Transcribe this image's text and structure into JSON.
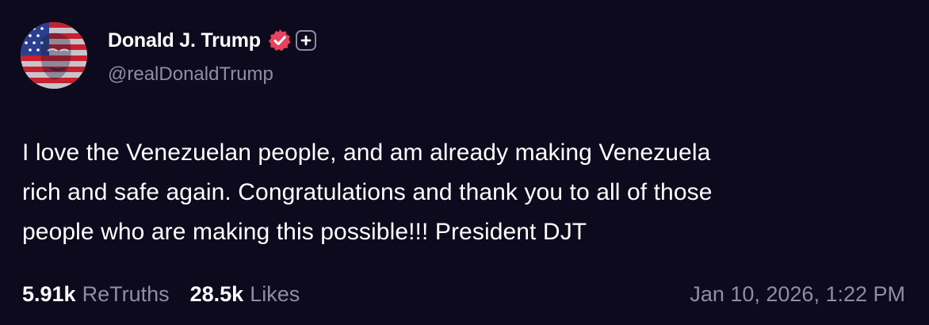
{
  "author": {
    "display_name": "Donald J. Trump",
    "handle": "@realDonaldTrump",
    "avatar_icon": "flag-portrait-avatar",
    "verified_icon": "verified-badge-icon",
    "plus_icon": "plus-badge-icon"
  },
  "post": {
    "lines": [
      "I love the Venezuelan people, and am already making Venezuela",
      "rich and safe again. Congratulations and thank you to all of those",
      "people who are making this possible!!! President DJT"
    ]
  },
  "stats": {
    "retruths_count": "5.91k",
    "retruths_label": "ReTruths",
    "likes_count": "28.5k",
    "likes_label": "Likes",
    "timestamp": "Jan 10, 2026, 1:22 PM"
  },
  "colors": {
    "background": "#0c0a1c",
    "text_primary": "#ffffff",
    "text_secondary": "#8e8da3",
    "verified_badge": "#e8405f"
  }
}
